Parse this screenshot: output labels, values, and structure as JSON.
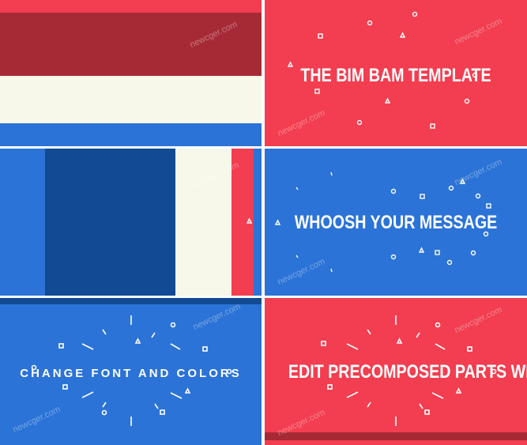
{
  "panels": {
    "p2": {
      "title": "THE BIM BAM TEMPLATE"
    },
    "p4": {
      "title": "WHOOSH YOUR MESSAGE"
    },
    "p5": {
      "title": "CHANGE FONT AND COLORS"
    },
    "p6": {
      "title": "EDIT PRECOMPOSED PARTS WITH EASE"
    }
  },
  "watermark": "newcger.com",
  "colors": {
    "red": "#f23e50",
    "blue": "#2b73d6",
    "dark_red": "#a62a36",
    "cream": "#f7f7ea",
    "navy": "#124a93"
  }
}
